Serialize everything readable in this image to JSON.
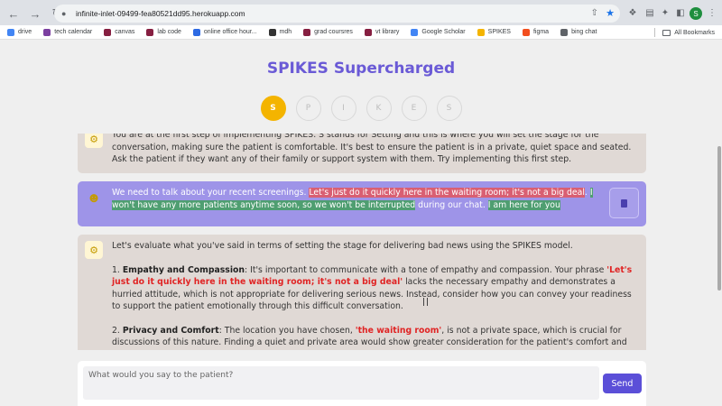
{
  "browser": {
    "url": "infinite-inlet-09499-fea80521dd95.herokuapp.com",
    "profile_initial": "S",
    "bookmarks": [
      {
        "label": "drive",
        "color": "#4285f4"
      },
      {
        "label": "tech calendar",
        "color": "#7b3fa0"
      },
      {
        "label": "canvas",
        "color": "#861f41"
      },
      {
        "label": "lab code",
        "color": "#861f41"
      },
      {
        "label": "online office hour...",
        "color": "#2d6ae3"
      },
      {
        "label": "mdh",
        "color": "#333333"
      },
      {
        "label": "grad coursres",
        "color": "#861f41"
      },
      {
        "label": "vt library",
        "color": "#861f41"
      },
      {
        "label": "Google Scholar",
        "color": "#4285f4"
      },
      {
        "label": "SPIKES",
        "color": "#f4b400"
      },
      {
        "label": "figma",
        "color": "#f24e1e"
      },
      {
        "label": "bing chat",
        "color": "#5f6368"
      }
    ],
    "all_bookmarks": "All Bookmarks"
  },
  "app": {
    "title": "SPIKES Supercharged",
    "steps": [
      "S",
      "P",
      "I",
      "K",
      "E",
      "S"
    ],
    "active_step": 0,
    "accent": "#6a5ad6"
  },
  "chat": {
    "message1": "You are at the first step of implementing SPIKES. S stands for Setting and this is where you will set the stage for the conversation, making sure the patient is comfortable. It's best to ensure the patient is in a private, quiet space and seated. Ask the patient if they want any of their family or support system with them. Try implementing this first step.",
    "user": {
      "part1": "We need to talk about your recent screenings. ",
      "part2_red": "Let's just do it quickly here in the waiting room; it's not a big deal",
      "part3": ". ",
      "part4_green": "I won't have any more patients anytime soon, so we won't be interrupted",
      "part5": " during our chat. ",
      "part6_green": "I am here for you"
    },
    "eval": {
      "intro": "Let's evaluate what you've said in terms of setting the stage for delivering bad news using the SPIKES model.",
      "p1_num": "1. ",
      "p1_title": "Empathy and Compassion",
      "p1_a": ": It's important to communicate with a tone of empathy and compassion. Your phrase ",
      "p1_quote": "'Let's just do it quickly here in the waiting room; it's not a big deal'",
      "p1_b": " lacks the necessary empathy and demonstrates a hurried attitude, which is not appropriate for delivering serious news. Instead, consider how you can convey your readiness to support the patient emotionally through this difficult conversation.",
      "p2_num": "2. ",
      "p2_title": "Privacy and Comfort",
      "p2_a": ": The location you have chosen, ",
      "p2_quote": "'the waiting room'",
      "p2_b": ", is not a private space, which is crucial for discussions of this nature. Finding a quiet and private area would show greater consideration for the patient's comfort and the sensitivity of the"
    }
  },
  "composer": {
    "placeholder": "What would you say to the patient?",
    "send_label": "Send"
  }
}
